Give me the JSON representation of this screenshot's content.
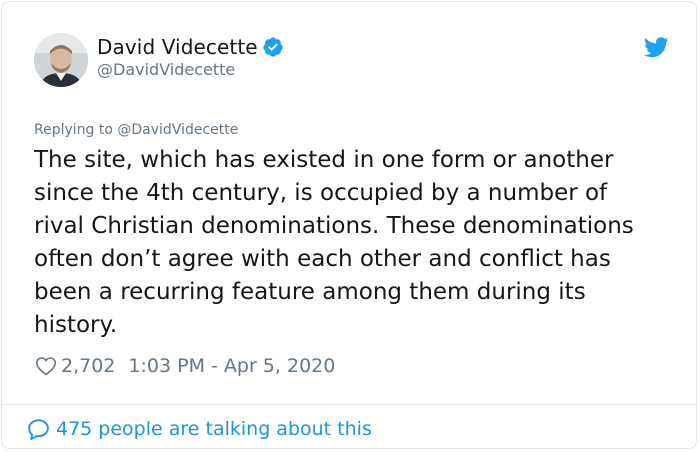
{
  "tweet": {
    "author_name": "David Videcette",
    "handle": "@DavidVidecette",
    "verified_icon": "verified-badge-icon",
    "platform_icon": "twitter-bird-icon",
    "replying_prefix": "Replying to",
    "replying_handle": "@DavidVidecette",
    "text": "The site, which has existed in one form or another\nsince the 4th century, is occupied by a number of\nrival Christian denominations. These denominations\noften don’t agree with each other and conflict has\nbeen a recurring feature among them during its\nhistory.",
    "likes": "2,702",
    "timestamp": "1:03 PM - Apr 5, 2020",
    "talking": "475 people are talking about this"
  },
  "colors": {
    "brand_blue": "#1da1f2",
    "link_blue": "#1b95e0",
    "secondary_text": "#657786",
    "primary_text": "#14171a",
    "border": "#e1e8ed"
  }
}
